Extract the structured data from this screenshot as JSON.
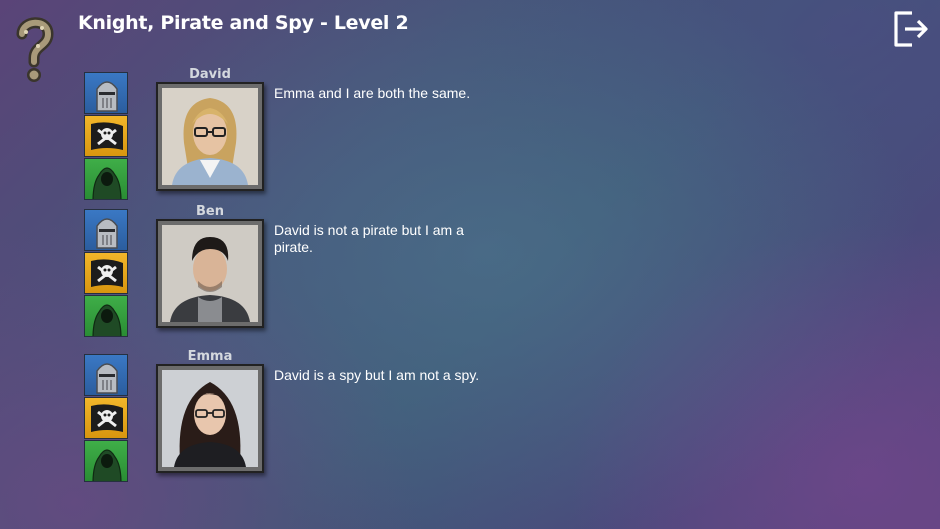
{
  "header": {
    "title": "Knight, Pirate and Spy - Level 2"
  },
  "roles": [
    "knight",
    "pirate",
    "spy"
  ],
  "characters": [
    {
      "name": "David",
      "statement": "Emma and I are both the same.",
      "hair": "blond"
    },
    {
      "name": "Ben",
      "statement": "David is not a pirate but I am a pirate.",
      "hair": "dark"
    },
    {
      "name": "Emma",
      "statement": "David is a spy but I am not a spy.",
      "hair": "brunette"
    }
  ],
  "colors": {
    "knight_tile": "#3a78c4",
    "pirate_tile": "#f2b62a",
    "spy_tile": "#3fae48"
  },
  "icons": {
    "help": "question-mark-icon",
    "exit": "exit-icon",
    "knight": "knight-helmet-icon",
    "pirate": "skull-crossbones-flag-icon",
    "spy": "hooded-spy-icon"
  }
}
